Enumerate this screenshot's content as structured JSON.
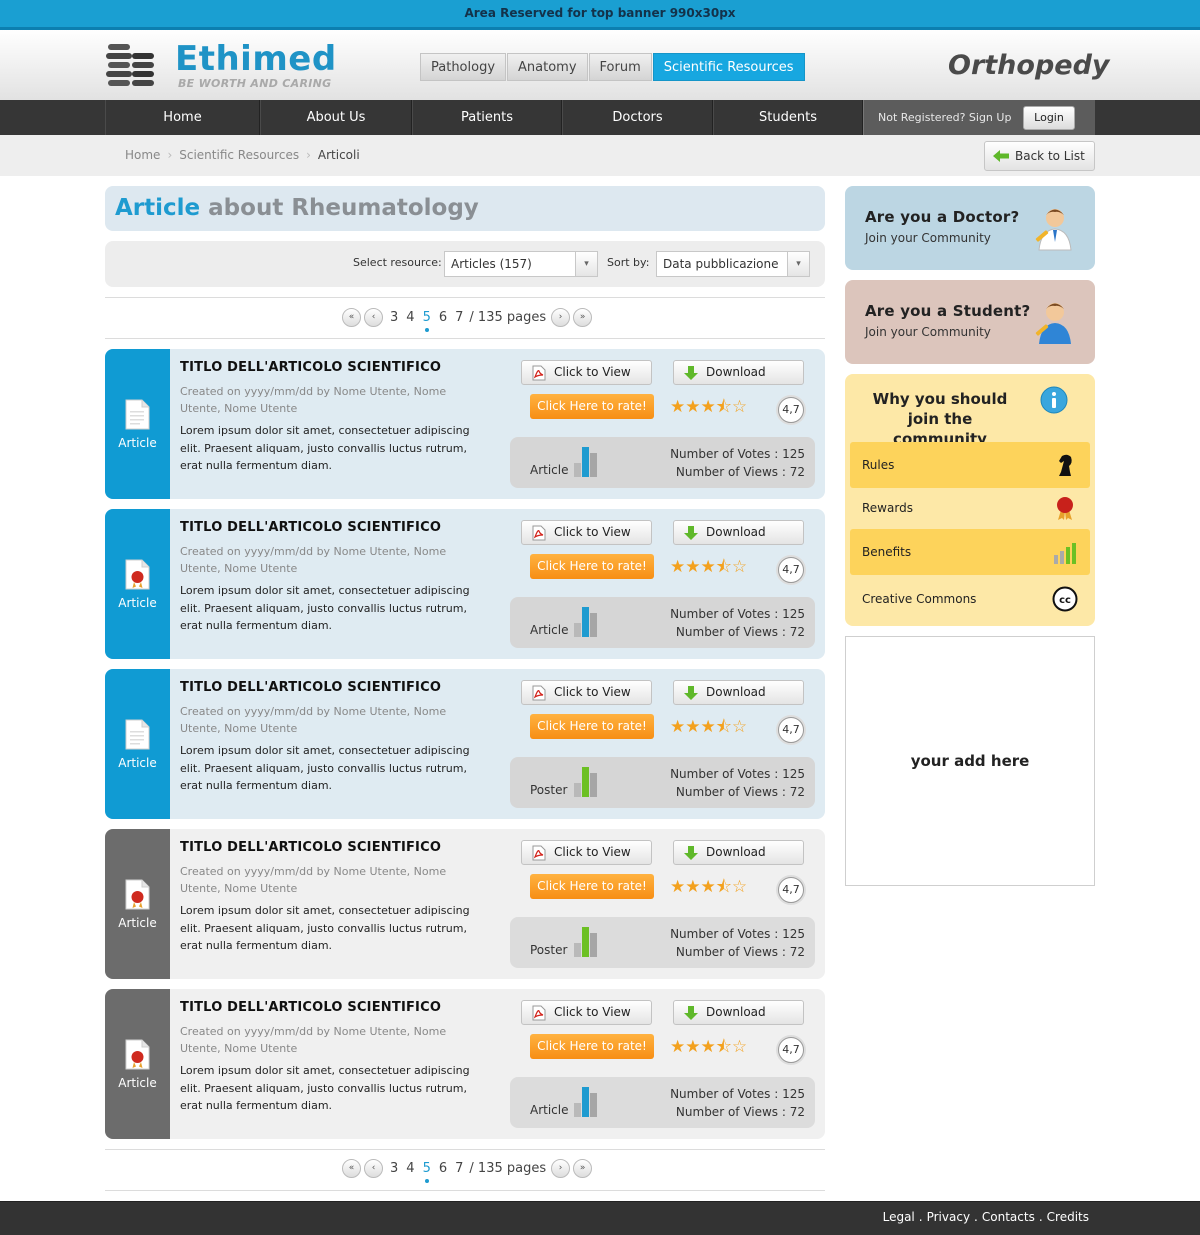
{
  "top_banner": "Area Reserved for top banner 990x30px",
  "brand": {
    "name": "Ethimed",
    "tagline": "BE WORTH AND CARING"
  },
  "top_nav": [
    {
      "label": "Pathology",
      "active": false
    },
    {
      "label": "Anatomy",
      "active": false
    },
    {
      "label": "Forum",
      "active": false
    },
    {
      "label": "Scientific Resources",
      "active": true
    }
  ],
  "site_section": "Orthopedy",
  "main_nav": [
    "Home",
    "About Us",
    "Patients",
    "Doctors",
    "Students"
  ],
  "account": {
    "signup_text": "Not Registered? Sign Up",
    "login_label": "Login"
  },
  "breadcrumb": [
    "Home",
    "Scientific Resources",
    "Articoli"
  ],
  "back_label": "Back to List",
  "page_title": {
    "highlight": "Article",
    "rest": "about Rheumatology"
  },
  "filters": {
    "resource_label": "Select resource:",
    "resource_value": "Articles (157)",
    "sort_label": "Sort by:",
    "sort_value": "Data pubblicazione"
  },
  "pager": {
    "first": "«",
    "prev": "‹",
    "pages": [
      "3",
      "4",
      "5",
      "6",
      "7"
    ],
    "current": "5",
    "total": "/ 135 pages",
    "next": "›",
    "last": "»"
  },
  "card_labels": {
    "view": "Click to View",
    "download": "Download",
    "rate": "Click Here to rate!",
    "stars": 3.5,
    "stars_max": 5
  },
  "articles": [
    {
      "theme": "blue",
      "side_label": "Article",
      "doc_icon": "document-icon",
      "title": "TITLO DELL'ARTICOLO SCIENTIFICO",
      "meta": "Created on yyyy/mm/dd by Nome Utente, Nome Utente, Nome Utente",
      "description": "Lorem ipsum dolor sit amet, consectetuer adipiscing elit. Praesent aliquam, justo convallis luctus rutrum, erat nulla fermentum diam.",
      "score": "4,7",
      "type": "Article",
      "chart_color": "#1e9bd0",
      "votes": "Number of Votes : 125",
      "views": "Number of Views : 72"
    },
    {
      "theme": "blue",
      "side_label": "Article",
      "doc_icon": "certificate-document-icon",
      "title": "TITLO DELL'ARTICOLO SCIENTIFICO",
      "meta": "Created on yyyy/mm/dd by Nome Utente, Nome Utente, Nome Utente",
      "description": "Lorem ipsum dolor sit amet, consectetuer adipiscing elit. Praesent aliquam, justo convallis luctus rutrum, erat nulla fermentum diam.",
      "score": "4,7",
      "type": "Article",
      "chart_color": "#1e9bd0",
      "votes": "Number of Votes : 125",
      "views": "Number of Views : 72"
    },
    {
      "theme": "blue",
      "side_label": "Article",
      "doc_icon": "document-icon",
      "title": "TITLO DELL'ARTICOLO SCIENTIFICO",
      "meta": "Created on yyyy/mm/dd by Nome Utente, Nome Utente, Nome Utente",
      "description": "Lorem ipsum dolor sit amet, consectetuer adipiscing elit. Praesent aliquam, justo convallis luctus rutrum, erat nulla fermentum diam.",
      "score": "4,7",
      "type": "Poster",
      "chart_color": "#6cc024",
      "votes": "Number of Votes : 125",
      "views": "Number of Views : 72"
    },
    {
      "theme": "gray",
      "side_label": "Article",
      "doc_icon": "certificate-document-icon",
      "title": "TITLO DELL'ARTICOLO SCIENTIFICO",
      "meta": "Created on yyyy/mm/dd by Nome Utente, Nome Utente, Nome Utente",
      "description": "Lorem ipsum dolor sit amet, consectetuer adipiscing elit. Praesent aliquam, justo convallis luctus rutrum, erat nulla fermentum diam.",
      "score": "4,7",
      "type": "Poster",
      "chart_color": "#6cc024",
      "votes": "Number of Votes : 125",
      "views": "Number of Views : 72"
    },
    {
      "theme": "gray",
      "side_label": "Article",
      "doc_icon": "certificate-document-icon",
      "title": "TITLO DELL'ARTICOLO SCIENTIFICO",
      "meta": "Created on yyyy/mm/dd by Nome Utente, Nome Utente, Nome Utente",
      "description": "Lorem ipsum dolor sit amet, consectetuer adipiscing elit. Praesent aliquam, justo convallis luctus rutrum, erat nulla fermentum diam.",
      "score": "4,7",
      "type": "Article",
      "chart_color": "#1e9bd0",
      "votes": "Number of Votes : 125",
      "views": "Number of Views : 72"
    }
  ],
  "sidebar": {
    "doctor": {
      "title": "Are you a Doctor?",
      "subtitle": "Join your Community",
      "bg": "#bcd6e3"
    },
    "student": {
      "title": "Are you a Student?",
      "subtitle": "Join your Community",
      "bg": "#dcc5bc"
    },
    "why": {
      "title": "Why you should join the community",
      "items": [
        {
          "label": "Rules",
          "icon": "chess-knight-icon",
          "highlight": true
        },
        {
          "label": "Rewards",
          "icon": "award-seal-icon",
          "highlight": false
        },
        {
          "label": "Benefits",
          "icon": "bar-chart-icon",
          "highlight": true
        },
        {
          "label": "Creative Commons",
          "icon": "creative-commons-icon",
          "highlight": false
        }
      ]
    },
    "ad": "your add here"
  },
  "footer": [
    "Legal",
    "Privacy",
    "Contacts",
    "Credits"
  ],
  "colors": {
    "accent": "#1e9bd0",
    "nav_dark": "#363636",
    "rate_orange": "#f78e14",
    "why_yellow": "#fde8a7"
  }
}
